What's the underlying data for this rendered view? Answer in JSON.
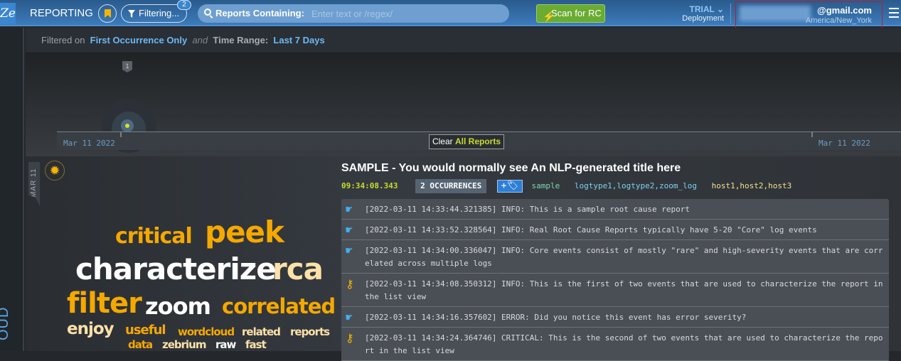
{
  "header": {
    "logo": "Ze",
    "app_title": "REPORTING",
    "filter_label": "Filtering...",
    "filter_count": "2",
    "search_label": "Reports Containing:",
    "search_placeholder": "Enter text or /regex/",
    "search_value": "",
    "scan_label": "Scan for RC",
    "plan": "TRIAL",
    "plan_sub": "Deployment",
    "email": "@gmail.com",
    "timezone": "America/New_York"
  },
  "sidebar": {
    "label": "OUD"
  },
  "filters": {
    "prefix": "Filtered on",
    "filter1": "First Occurrence Only",
    "joiner": "and",
    "range_label": "Time Range:",
    "range_value": "Last 7 Days"
  },
  "timeline": {
    "pin_count": "1",
    "start_date": "Mar 11 2022",
    "end_date": "Mar 11 2022",
    "clear_prefix": "Clear",
    "clear_target": "All Reports"
  },
  "report": {
    "date_tab": "MAR 11",
    "title": "SAMPLE - You would normally see An NLP-generated title here",
    "time": "09:34:08.343",
    "occurrences": "2 OCCURRENCES",
    "tag_button": "+🏷",
    "meta1": "sample",
    "meta2": "logtype1,logtype2,zoom_log",
    "meta3": "host1,host2,host3",
    "wordcloud": [
      "critical",
      "peek",
      "characterize",
      "rca",
      "filter",
      "zoom",
      "correlated",
      "enjoy",
      "useful",
      "wordcloud",
      "related",
      "reports",
      "data",
      "zebrium",
      "raw",
      "fast"
    ],
    "logs": [
      {
        "icon": "pointing-hand",
        "text": "[2022-03-11 14:33:44.321385] INFO: This is a sample root cause report"
      },
      {
        "icon": "pointing-hand",
        "text": "[2022-03-11 14:33:52.328564] INFO: Real Root Cause Reports typically have 5-20 \"Core\" log events"
      },
      {
        "icon": "pointing-hand",
        "text": "[2022-03-11 14:34:00.336047] INFO: Core events consist of mostly \"rare\" and high-severity events that are correlated across multiple logs"
      },
      {
        "icon": "key",
        "text": "[2022-03-11 14:34:08.350312] INFO: This is the first of two events that are used to characterize the report in the list view"
      },
      {
        "icon": "pointing-hand",
        "text": "[2022-03-11 14:34:16.357602] ERROR: Did you notice this event has error severity?"
      },
      {
        "icon": "key",
        "text": "[2022-03-11 14:34:24.364746] CRITICAL: This is the second of two events that are used to characterize the report in the list view"
      }
    ]
  }
}
